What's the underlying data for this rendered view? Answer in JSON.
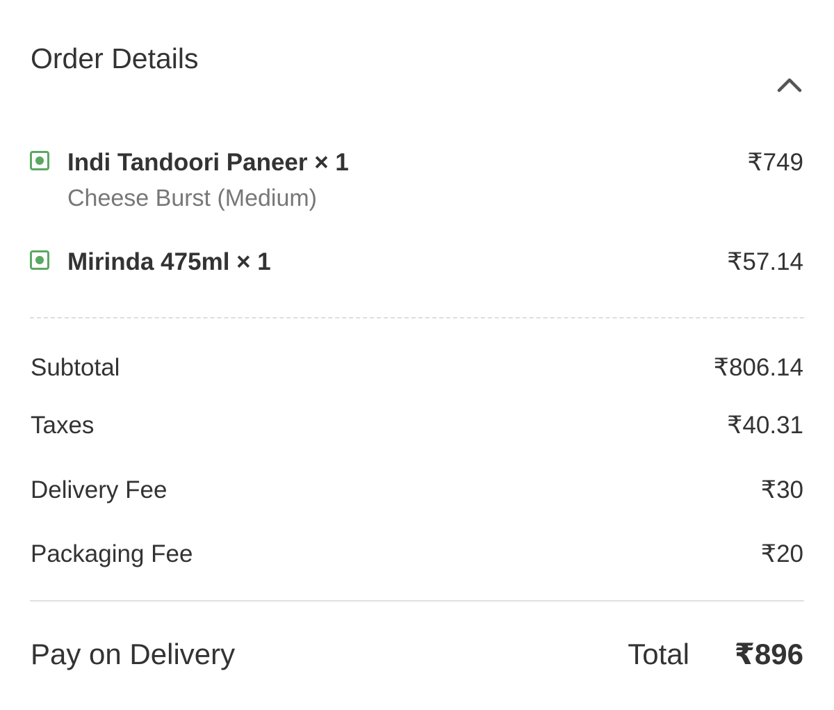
{
  "header": {
    "title": "Order Details",
    "toggle_icon": "chevron-up-icon"
  },
  "items": [
    {
      "name": "Indi Tandoori Paneer × 1",
      "variant": "Cheese Burst (Medium)",
      "price": "₹749",
      "veg_icon": "veg-indicator-icon"
    },
    {
      "name": "Mirinda 475ml × 1",
      "variant": "",
      "price": "₹57.14",
      "veg_icon": "veg-indicator-icon"
    }
  ],
  "summary": {
    "subtotal": {
      "label": "Subtotal",
      "value": "₹806.14"
    },
    "taxes": {
      "label": "Taxes",
      "value": "₹40.31"
    },
    "delivery_fee": {
      "label": "Delivery Fee",
      "value": "₹30"
    },
    "packaging_fee": {
      "label": "Packaging Fee",
      "value": "₹20"
    }
  },
  "footer": {
    "payment_method": "Pay on Delivery",
    "total_label": "Total",
    "total_value": "₹896"
  },
  "colors": {
    "veg_green": "#5ba862",
    "text_primary": "#333333",
    "text_secondary": "#777777",
    "divider": "#e0e0e0"
  }
}
